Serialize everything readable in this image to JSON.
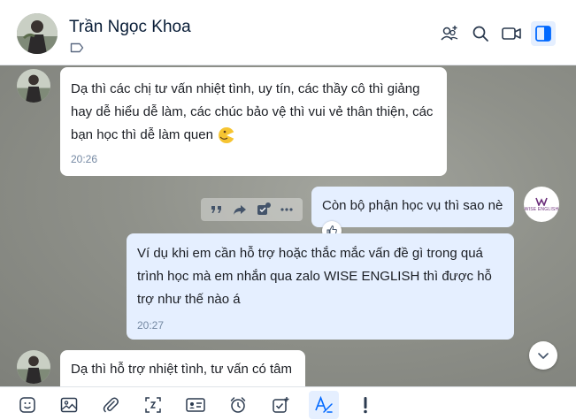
{
  "header": {
    "contact_name": "Trần Ngọc Khoa",
    "icons": [
      "add-friend-icon",
      "search-icon",
      "video-call-icon",
      "sidebar-toggle-icon"
    ]
  },
  "messages": {
    "m1": {
      "text": "Dạ thì các chị tư vấn nhiệt tình, uy tín, các thầy cô thì giảng hay dễ hiểu dễ làm, các chúc bảo vệ thì vui vẻ thân thiện, các bạn học thì dễ làm quen",
      "time": "20:26"
    },
    "m2": {
      "text": "Còn bộ phận học vụ thì sao nè"
    },
    "m3": {
      "text": "Ví dụ khi em cần hỗ trợ hoặc thắc mắc vấn đề gì trong quá trình học mà em nhắn qua zalo WISE ENGLISH thì được hỗ trợ như thế nào á",
      "time": "20:27"
    },
    "m4": {
      "text": "Dạ thì hỗ trợ nhiệt tình, tư vấn có tâm"
    }
  },
  "brand": {
    "logo_text": "WISE ENGLISH"
  },
  "colors": {
    "accent": "#0068ff",
    "out_bubble": "#e5efff",
    "in_bubble": "#ffffff"
  },
  "toolbar": {
    "icons": [
      "sticker-icon",
      "image-icon",
      "attachment-icon",
      "screenshot-icon",
      "contact-card-icon",
      "reminder-icon",
      "task-icon",
      "text-format-icon",
      "urgent-icon"
    ]
  }
}
